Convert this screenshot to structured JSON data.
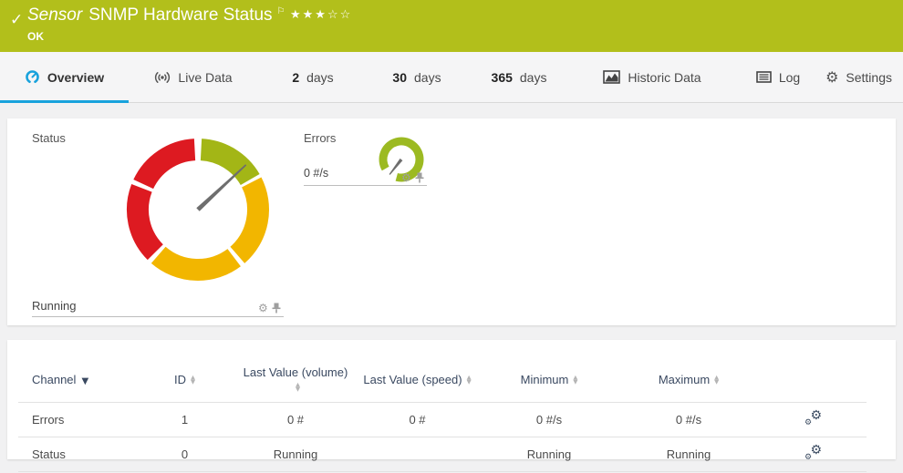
{
  "colors": {
    "banner_green": "#b2bf1b",
    "accent_blue": "#18a2dc",
    "gauge_red": "#dd1a21",
    "gauge_yellow": "#f2b600",
    "gauge_green": "#a3b616",
    "mini_gauge_green": "#9cba22",
    "needle_gray": "#6e6e6e"
  },
  "header": {
    "sensor_label": "Sensor",
    "sensor_name": "SNMP Hardware Status",
    "status_text": "OK",
    "rating_stars": "★★★☆☆",
    "rating_filled": 3,
    "rating_total": 5
  },
  "tabs": [
    {
      "label": "Overview",
      "active": true
    },
    {
      "label": "Live Data"
    },
    {
      "prefix": "2",
      "label": "days"
    },
    {
      "prefix": "30",
      "label": "days"
    },
    {
      "prefix": "365",
      "label": "days"
    },
    {
      "label": "Historic Data"
    },
    {
      "label": "Log"
    },
    {
      "label": "Settings"
    }
  ],
  "overview": {
    "status_gauge": {
      "title": "Status",
      "value": "Running",
      "needle_angle_deg": 47,
      "segments": [
        {
          "color_key": "gauge_green",
          "from_deg": 3,
          "to_deg": 60
        },
        {
          "color_key": "gauge_yellow",
          "from_deg": 63,
          "to_deg": 139
        },
        {
          "color_key": "gauge_yellow",
          "from_deg": 143,
          "to_deg": 221
        },
        {
          "color_key": "gauge_red",
          "from_deg": 225,
          "to_deg": 291
        },
        {
          "color_key": "gauge_red",
          "from_deg": 295,
          "to_deg": 357
        }
      ]
    },
    "errors_gauge": {
      "title": "Errors",
      "value": "0 #/s",
      "needle_angle_deg": 218
    }
  },
  "table": {
    "sort_column": "Channel",
    "sort_direction": "desc",
    "columns": [
      {
        "label": "Channel"
      },
      {
        "label": "ID"
      },
      {
        "label": "Last Value (volume)"
      },
      {
        "label": "Last Value (speed)"
      },
      {
        "label": "Minimum"
      },
      {
        "label": "Maximum"
      }
    ],
    "rows": [
      {
        "channel": "Errors",
        "id": "1",
        "last_value_volume": "0 #",
        "last_value_speed": "0 #",
        "minimum": "0 #/s",
        "maximum": "0 #/s"
      },
      {
        "channel": "Status",
        "id": "0",
        "last_value_volume": "Running",
        "last_value_speed": "",
        "minimum": "Running",
        "maximum": "Running"
      }
    ]
  }
}
